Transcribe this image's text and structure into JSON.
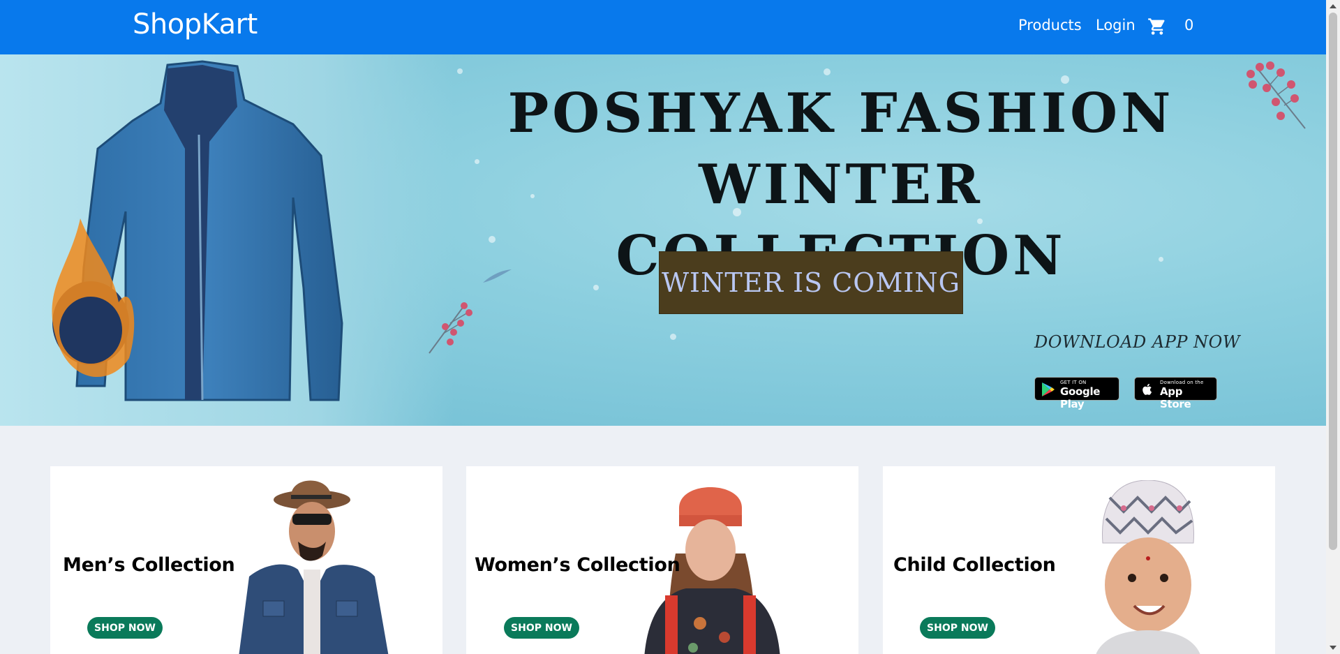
{
  "navbar": {
    "brand": "ShopKart",
    "links": [
      {
        "label": "Products"
      },
      {
        "label": "Login"
      }
    ],
    "cart_icon": "shopping-cart-icon",
    "cart_count": "0"
  },
  "hero": {
    "title_line1": "POSHYAK FASHION",
    "title_line2": "WINTER COLLECTION",
    "cta": "WINTER IS COMING",
    "download_text": "DOWNLOAD APP NOW",
    "google_badge": {
      "small": "GET IT ON",
      "big": "Google Play"
    },
    "apple_badge": {
      "small": "Download on the",
      "big": "App Store"
    }
  },
  "collections": [
    {
      "title": "Men’s Collection",
      "button": "SHOP NOW"
    },
    {
      "title": "Women’s Collection",
      "button": "SHOP NOW"
    },
    {
      "title": "Child Collection",
      "button": "SHOP NOW"
    }
  ],
  "colors": {
    "navbar": "#0879ec",
    "hero_button_bg": "#4b3d1d",
    "hero_button_text": "#b9c7f2",
    "shop_now_bg": "#0a7a5a",
    "page_bg": "#edf0f5"
  }
}
